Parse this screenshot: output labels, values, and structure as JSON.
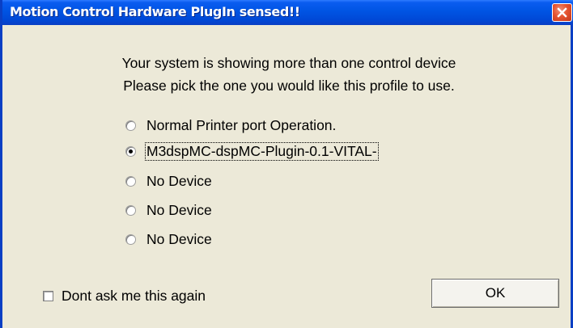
{
  "window": {
    "title": "Motion Control Hardware PlugIn sensed!!"
  },
  "message": {
    "line1": "Your system is showing more than one control device",
    "line2": "Please pick the one you would like this profile to use."
  },
  "options": [
    {
      "label": "Normal Printer port Operation.",
      "checked": false
    },
    {
      "label": "M3dspMC-dspMC-Plugin-0.1-VITAL-",
      "checked": true
    },
    {
      "label": "No Device",
      "checked": false
    },
    {
      "label": "No Device",
      "checked": false
    },
    {
      "label": "No Device",
      "checked": false
    }
  ],
  "dont_ask": {
    "label": "Dont ask me this again",
    "checked": false
  },
  "ok_button": {
    "label": "OK"
  },
  "colors": {
    "titlebar": "#0054e3",
    "window_bg": "#ece9d8",
    "close_button": "#e5532f"
  },
  "icons": {
    "close": "close-icon"
  }
}
